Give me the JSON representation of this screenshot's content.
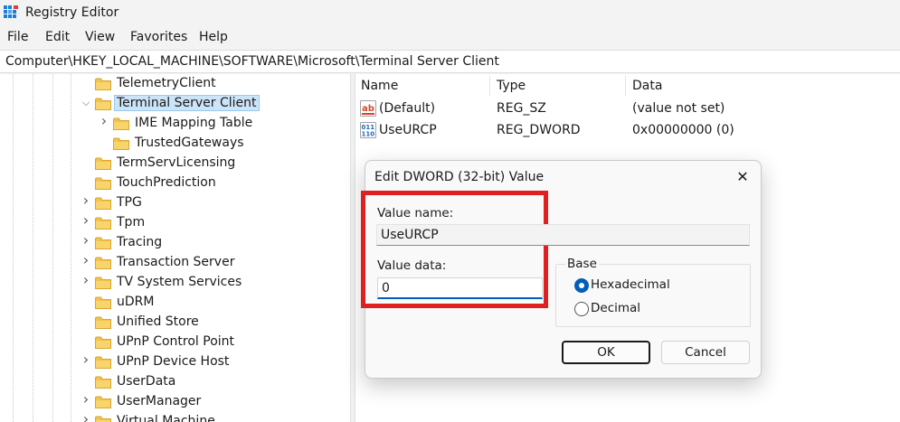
{
  "window": {
    "title": "Registry Editor",
    "icon": "registry-editor-icon"
  },
  "menu": [
    "File",
    "Edit",
    "View",
    "Favorites",
    "Help"
  ],
  "address": "Computer\\HKEY_LOCAL_MACHINE\\SOFTWARE\\Microsoft\\Terminal Server Client",
  "tree": {
    "items": [
      {
        "label": "TelemetryClient",
        "expander": ""
      },
      {
        "label": "Terminal Server Client",
        "expander": "expanded",
        "selected": true
      },
      {
        "label": "IME Mapping Table",
        "expander": "collapsed",
        "child": true
      },
      {
        "label": "TrustedGateways",
        "expander": "",
        "child": true
      },
      {
        "label": "TermServLicensing",
        "expander": ""
      },
      {
        "label": "TouchPrediction",
        "expander": ""
      },
      {
        "label": "TPG",
        "expander": "collapsed"
      },
      {
        "label": "Tpm",
        "expander": "collapsed"
      },
      {
        "label": "Tracing",
        "expander": "collapsed"
      },
      {
        "label": "Transaction Server",
        "expander": "collapsed"
      },
      {
        "label": "TV System Services",
        "expander": "collapsed"
      },
      {
        "label": "uDRM",
        "expander": ""
      },
      {
        "label": "Unified Store",
        "expander": ""
      },
      {
        "label": "UPnP Control Point",
        "expander": ""
      },
      {
        "label": "UPnP Device Host",
        "expander": "collapsed"
      },
      {
        "label": "UserData",
        "expander": ""
      },
      {
        "label": "UserManager",
        "expander": "collapsed"
      },
      {
        "label": "Virtual Machine",
        "expander": "collapsed"
      }
    ]
  },
  "list": {
    "columns": [
      "Name",
      "Type",
      "Data"
    ],
    "rows": [
      {
        "name": "(Default)",
        "type": "REG_SZ",
        "data": "(value not set)",
        "icon": "string-value-icon"
      },
      {
        "name": "UseURCP",
        "type": "REG_DWORD",
        "data": "0x00000000 (0)",
        "icon": "binary-value-icon"
      }
    ]
  },
  "dialog": {
    "title": "Edit DWORD (32-bit) Value",
    "value_name_label": "Value name:",
    "value_name": "UseURCP",
    "value_data_label": "Value data:",
    "value_data": "0",
    "base_label": "Base",
    "base_options": [
      "Hexadecimal",
      "Decimal"
    ],
    "base_selected": "Hexadecimal",
    "ok": "OK",
    "cancel": "Cancel",
    "highlight_color": "#e02020"
  },
  "colors": {
    "accent": "#005fb8",
    "selection": "#cce4f7",
    "folder": "#f3c24b"
  }
}
